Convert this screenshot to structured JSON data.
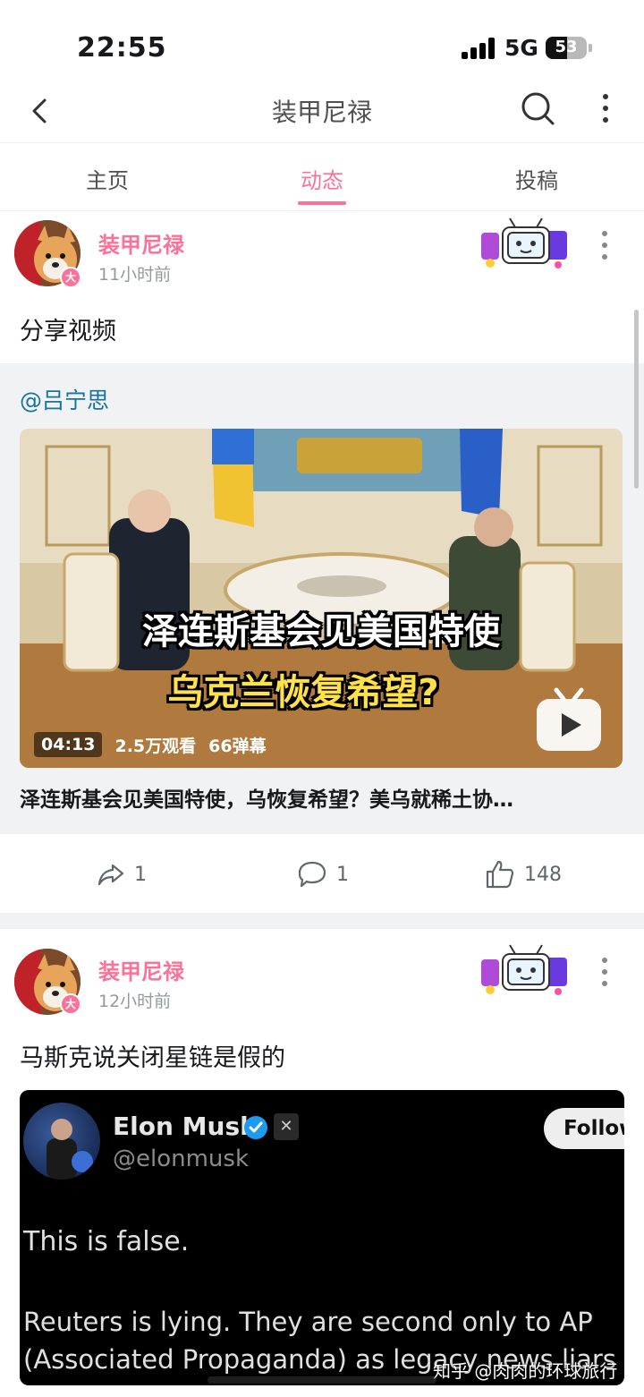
{
  "status_bar": {
    "time": "22:55",
    "network": "5G",
    "battery": "53"
  },
  "nav": {
    "title": "装甲尼禄"
  },
  "tabs": [
    {
      "label": "主页",
      "active": false
    },
    {
      "label": "动态",
      "active": true
    },
    {
      "label": "投稿",
      "active": false
    }
  ],
  "posts": [
    {
      "author": "装甲尼禄",
      "avatar_badge": "大",
      "time": "11小时前",
      "text": "分享视频",
      "shared": {
        "mention": "@吕宁思",
        "thumbnail_overlay": [
          "泽连斯基会见美国特使",
          "乌克兰恢复希望?"
        ],
        "duration": "04:13",
        "views": "2.5万观看",
        "danmaku": "66弹幕",
        "title": "泽连斯基会见美国特使，乌恢复希望？美乌就稀土协…"
      },
      "stats": {
        "shares": "1",
        "comments": "1",
        "likes": "148"
      }
    },
    {
      "author": "装甲尼禄",
      "avatar_badge": "大",
      "time": "12小时前",
      "text": "马斯克说关闭星链是假的",
      "tweet": {
        "name": "Elon Musk",
        "handle": "@elonmusk",
        "follow_label": "Follow",
        "line1": "This is false.",
        "line2": "Reuters is lying. They are second only to AP",
        "line3": "(Associated Propaganda) as legacy news liars"
      }
    }
  ],
  "watermark": "知乎 @肉肉的环球旅行",
  "colors": {
    "accent": "#fb7299",
    "mention": "#17739c",
    "card_bg": "#f1f2f3"
  }
}
